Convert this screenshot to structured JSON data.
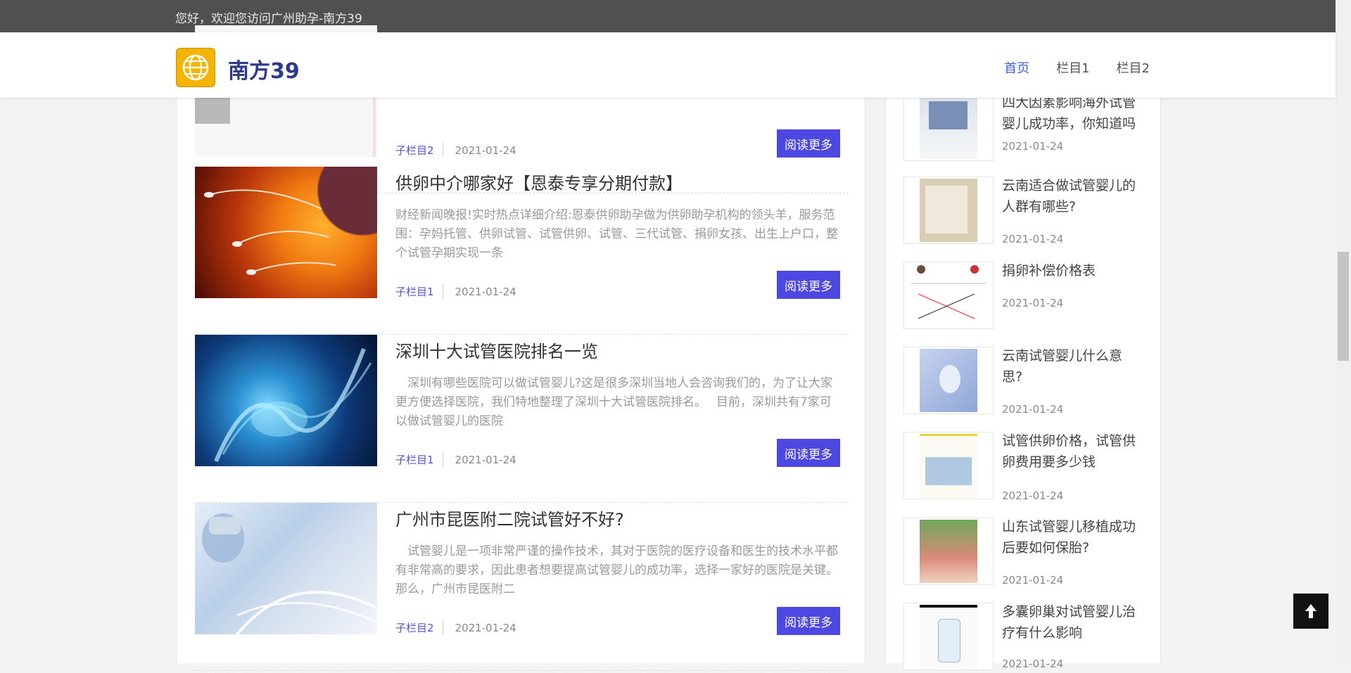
{
  "topbar": {
    "welcome": "您好，欢迎您访问广州助孕-南方39"
  },
  "header": {
    "logo_text": "南方39",
    "nav": [
      {
        "label": "首页",
        "active": true
      },
      {
        "label": "栏目1",
        "active": false
      },
      {
        "label": "栏目2",
        "active": false
      }
    ]
  },
  "articles": [
    {
      "title": "",
      "summary": "",
      "category": "子栏目2",
      "date": "2021-01-24",
      "button": "阅读更多"
    },
    {
      "title": "供卵中介哪家好【恩泰专享分期付款】",
      "summary": "财经新闻晚报!实时热点详细介绍:恩泰供卵助孕做为供卵助孕机构的领头羊，服务范围：孕妈托管、供卵试管、试管供卵、试管、三代试管、捐卵女孩、出生上户口，整个试管孕期实现一条",
      "category": "子栏目1",
      "date": "2021-01-24",
      "button": "阅读更多"
    },
    {
      "title": "深圳十大试管医院排名一览",
      "summary": "　深圳有哪些医院可以做试管婴儿?这是很多深圳当地人会咨询我们的，为了让大家更方便选择医院，我们特地整理了深圳十大试管医院排名。　 目前，深圳共有7家可以做试管婴儿的医院",
      "category": "子栏目1",
      "date": "2021-01-24",
      "button": "阅读更多"
    },
    {
      "title": "广州市昆医附二院试管好不好?",
      "summary": "　试管婴儿是一项非常严谨的操作技术，其对于医院的医疗设备和医生的技术水平都有非常高的要求，因此患者想要提高试管婴儿的成功率，选择一家好的医院是关键。那么，广州市昆医附二",
      "category": "子栏目2",
      "date": "2021-01-24",
      "button": "阅读更多"
    }
  ],
  "sidebar": [
    {
      "title": "四大因素影响海外试管婴儿成功率，你知道吗",
      "date": "2021-01-24"
    },
    {
      "title": "云南适合做试管婴儿的人群有哪些?",
      "date": "2021-01-24"
    },
    {
      "title": "捐卵补偿价格表",
      "date": "2021-01-24"
    },
    {
      "title": "云南试管婴儿什么意思?",
      "date": "2021-01-24"
    },
    {
      "title": "试管供卵价格，试管供卵费用要多少钱",
      "date": "2021-01-24"
    },
    {
      "title": "山东试管婴儿移植成功后要如何保胎?",
      "date": "2021-01-24"
    },
    {
      "title": "多囊卵巢对试管婴儿治疗有什么影响",
      "date": "2021-01-24"
    }
  ],
  "icons": {
    "logo": "globe-icon",
    "backtop": "arrow-up-icon"
  },
  "colors": {
    "accent": "#4e48e2",
    "nav_active": "#3d63d6",
    "topbar": "#505050"
  }
}
